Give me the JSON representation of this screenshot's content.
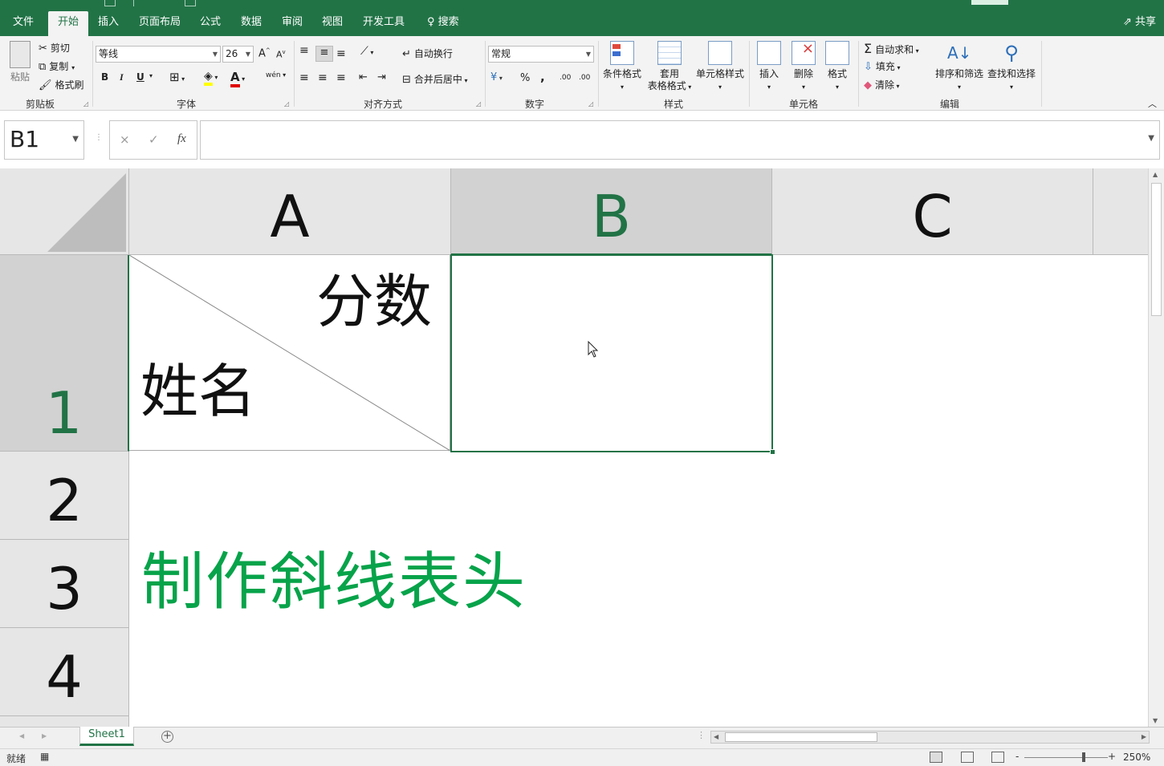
{
  "app": {
    "tabs": [
      "文件",
      "开始",
      "插入",
      "页面布局",
      "公式",
      "数据",
      "审阅",
      "视图",
      "开发工具"
    ],
    "active_tab": "开始",
    "search": "搜索",
    "share": "共享"
  },
  "ribbon": {
    "clipboard": {
      "paste": "粘贴",
      "cut": "剪切",
      "copy": "复制",
      "format_painter": "格式刷",
      "label": "剪贴板"
    },
    "font": {
      "name": "等线",
      "size": "26",
      "grow": "A",
      "shrink": "A",
      "bold": "B",
      "italic": "I",
      "underline": "U",
      "phonetic": "wén",
      "label": "字体"
    },
    "alignment": {
      "wrap": "自动换行",
      "merge": "合并后居中",
      "label": "对齐方式"
    },
    "number": {
      "format": "常规",
      "percent": "%",
      "comma": ",",
      "inc_decimal": ".00",
      "dec_decimal": ".00",
      "label": "数字"
    },
    "styles": {
      "conditional": "条件格式",
      "table_line1": "套用",
      "table_line2": "表格格式",
      "cell_styles": "单元格样式",
      "label": "样式"
    },
    "cells": {
      "insert": "插入",
      "delete": "删除",
      "format": "格式",
      "label": "单元格"
    },
    "editing": {
      "autosum": "自动求和",
      "fill": "填充",
      "clear": "清除",
      "sort_filter": "排序和筛选",
      "find_select": "查找和选择",
      "label": "编辑"
    }
  },
  "formula_bar": {
    "name_box": "B1",
    "cancel": "×",
    "enter": "✓",
    "fx": "fx",
    "value": ""
  },
  "sheet": {
    "columns": [
      "A",
      "B",
      "C"
    ],
    "rows": [
      "1",
      "2",
      "3",
      "4"
    ],
    "cell_A1_top": "分数",
    "cell_A1_bottom": "姓名",
    "cell_A3": "制作斜线表头",
    "selected_cell": "B1",
    "text_color_A3": "#07a34a"
  },
  "sheet_tabs": [
    "Sheet1"
  ],
  "status": {
    "ready": "就绪",
    "zoom": "250%",
    "zoom_minus": "-",
    "zoom_plus": "+"
  },
  "colors": {
    "accent": "#217346"
  }
}
